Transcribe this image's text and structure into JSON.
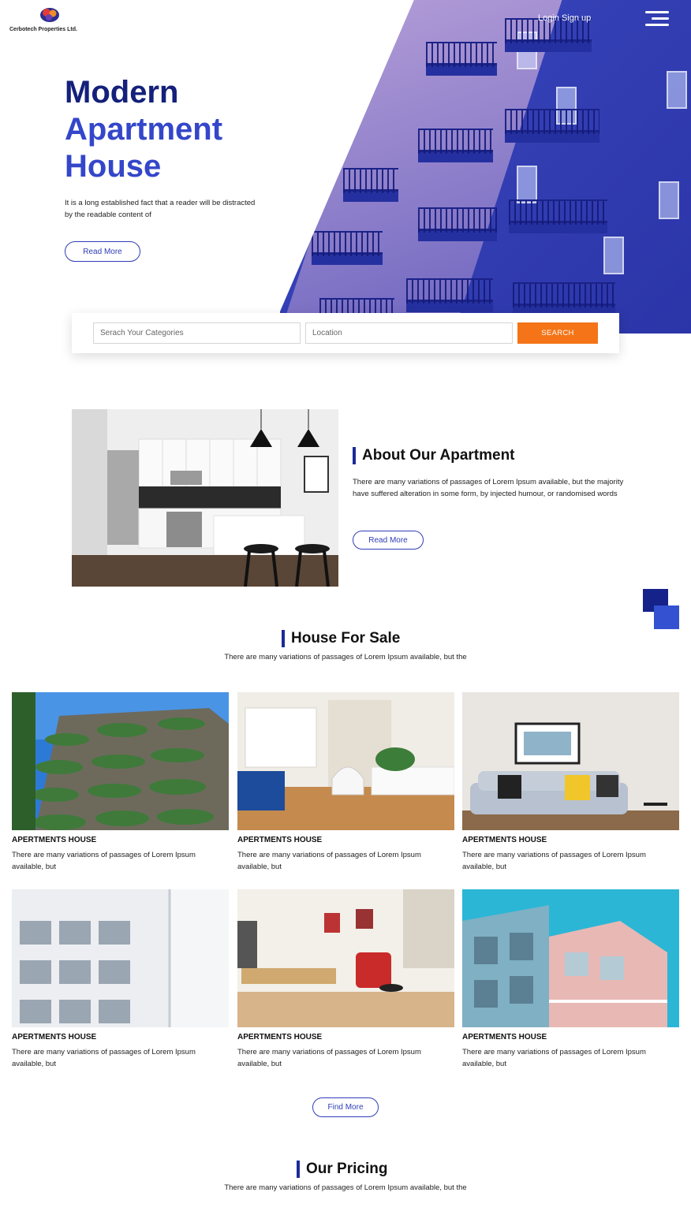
{
  "brand": {
    "name": "Cerbotech Properties Ltd."
  },
  "nav": {
    "auth": "Login Sign up"
  },
  "hero": {
    "title_line1": "Modern",
    "title_line2": "Apartment",
    "title_line3": "House",
    "text": "It is a long established fact that a reader will be distracted by the readable content of",
    "button": "Read More"
  },
  "search": {
    "category_placeholder": "Serach Your Categories",
    "location_placeholder": "Location",
    "button": "SEARCH"
  },
  "about": {
    "heading": "About Our Apartment",
    "text": "There are many variations of passages of Lorem Ipsum available, but the majority have suffered alteration in some form, by injected humour, or randomised words",
    "button": "Read More"
  },
  "sale": {
    "heading": "House For Sale",
    "subtitle": "There are many variations of passages of Lorem Ipsum available, but the",
    "cards": [
      {
        "title": "APERTMENTS HOUSE",
        "text": "There are many variations of passages of Lorem Ipsum available, but"
      },
      {
        "title": "APERTMENTS HOUSE",
        "text": "There are many variations of passages of Lorem Ipsum available, but"
      },
      {
        "title": "APERTMENTS HOUSE",
        "text": "There are many variations of passages of Lorem Ipsum available, but"
      },
      {
        "title": "APERTMENTS HOUSE",
        "text": "There are many variations of passages of Lorem Ipsum available, but"
      },
      {
        "title": "APERTMENTS HOUSE",
        "text": "There are many variations of passages of Lorem Ipsum available, but"
      },
      {
        "title": "APERTMENTS HOUSE",
        "text": "There are many variations of passages of Lorem Ipsum available, but"
      }
    ],
    "button": "Find More"
  },
  "pricing": {
    "heading": "Our Pricing",
    "subtitle": "There are many variations of passages of Lorem Ipsum available, but the"
  },
  "colors": {
    "primary_dark": "#14207a",
    "primary": "#3446c9",
    "accent": "#f47417"
  },
  "icons": [
    "logo-icon",
    "menu-icon"
  ]
}
